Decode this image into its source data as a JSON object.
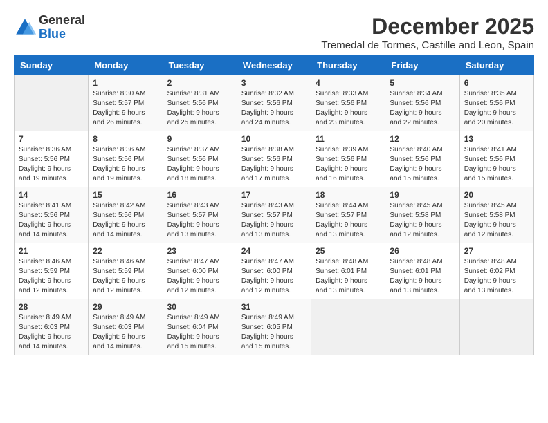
{
  "logo": {
    "general": "General",
    "blue": "Blue"
  },
  "title": "December 2025",
  "location": "Tremedal de Tormes, Castille and Leon, Spain",
  "days_of_week": [
    "Sunday",
    "Monday",
    "Tuesday",
    "Wednesday",
    "Thursday",
    "Friday",
    "Saturday"
  ],
  "weeks": [
    [
      {
        "day": "",
        "sunrise": "",
        "sunset": "",
        "daylight": ""
      },
      {
        "day": "1",
        "sunrise": "Sunrise: 8:30 AM",
        "sunset": "Sunset: 5:57 PM",
        "daylight": "Daylight: 9 hours and 26 minutes."
      },
      {
        "day": "2",
        "sunrise": "Sunrise: 8:31 AM",
        "sunset": "Sunset: 5:56 PM",
        "daylight": "Daylight: 9 hours and 25 minutes."
      },
      {
        "day": "3",
        "sunrise": "Sunrise: 8:32 AM",
        "sunset": "Sunset: 5:56 PM",
        "daylight": "Daylight: 9 hours and 24 minutes."
      },
      {
        "day": "4",
        "sunrise": "Sunrise: 8:33 AM",
        "sunset": "Sunset: 5:56 PM",
        "daylight": "Daylight: 9 hours and 23 minutes."
      },
      {
        "day": "5",
        "sunrise": "Sunrise: 8:34 AM",
        "sunset": "Sunset: 5:56 PM",
        "daylight": "Daylight: 9 hours and 22 minutes."
      },
      {
        "day": "6",
        "sunrise": "Sunrise: 8:35 AM",
        "sunset": "Sunset: 5:56 PM",
        "daylight": "Daylight: 9 hours and 20 minutes."
      }
    ],
    [
      {
        "day": "7",
        "sunrise": "Sunrise: 8:36 AM",
        "sunset": "Sunset: 5:56 PM",
        "daylight": "Daylight: 9 hours and 19 minutes."
      },
      {
        "day": "8",
        "sunrise": "Sunrise: 8:36 AM",
        "sunset": "Sunset: 5:56 PM",
        "daylight": "Daylight: 9 hours and 19 minutes."
      },
      {
        "day": "9",
        "sunrise": "Sunrise: 8:37 AM",
        "sunset": "Sunset: 5:56 PM",
        "daylight": "Daylight: 9 hours and 18 minutes."
      },
      {
        "day": "10",
        "sunrise": "Sunrise: 8:38 AM",
        "sunset": "Sunset: 5:56 PM",
        "daylight": "Daylight: 9 hours and 17 minutes."
      },
      {
        "day": "11",
        "sunrise": "Sunrise: 8:39 AM",
        "sunset": "Sunset: 5:56 PM",
        "daylight": "Daylight: 9 hours and 16 minutes."
      },
      {
        "day": "12",
        "sunrise": "Sunrise: 8:40 AM",
        "sunset": "Sunset: 5:56 PM",
        "daylight": "Daylight: 9 hours and 15 minutes."
      },
      {
        "day": "13",
        "sunrise": "Sunrise: 8:41 AM",
        "sunset": "Sunset: 5:56 PM",
        "daylight": "Daylight: 9 hours and 15 minutes."
      }
    ],
    [
      {
        "day": "14",
        "sunrise": "Sunrise: 8:41 AM",
        "sunset": "Sunset: 5:56 PM",
        "daylight": "Daylight: 9 hours and 14 minutes."
      },
      {
        "day": "15",
        "sunrise": "Sunrise: 8:42 AM",
        "sunset": "Sunset: 5:56 PM",
        "daylight": "Daylight: 9 hours and 14 minutes."
      },
      {
        "day": "16",
        "sunrise": "Sunrise: 8:43 AM",
        "sunset": "Sunset: 5:57 PM",
        "daylight": "Daylight: 9 hours and 13 minutes."
      },
      {
        "day": "17",
        "sunrise": "Sunrise: 8:43 AM",
        "sunset": "Sunset: 5:57 PM",
        "daylight": "Daylight: 9 hours and 13 minutes."
      },
      {
        "day": "18",
        "sunrise": "Sunrise: 8:44 AM",
        "sunset": "Sunset: 5:57 PM",
        "daylight": "Daylight: 9 hours and 13 minutes."
      },
      {
        "day": "19",
        "sunrise": "Sunrise: 8:45 AM",
        "sunset": "Sunset: 5:58 PM",
        "daylight": "Daylight: 9 hours and 12 minutes."
      },
      {
        "day": "20",
        "sunrise": "Sunrise: 8:45 AM",
        "sunset": "Sunset: 5:58 PM",
        "daylight": "Daylight: 9 hours and 12 minutes."
      }
    ],
    [
      {
        "day": "21",
        "sunrise": "Sunrise: 8:46 AM",
        "sunset": "Sunset: 5:59 PM",
        "daylight": "Daylight: 9 hours and 12 minutes."
      },
      {
        "day": "22",
        "sunrise": "Sunrise: 8:46 AM",
        "sunset": "Sunset: 5:59 PM",
        "daylight": "Daylight: 9 hours and 12 minutes."
      },
      {
        "day": "23",
        "sunrise": "Sunrise: 8:47 AM",
        "sunset": "Sunset: 6:00 PM",
        "daylight": "Daylight: 9 hours and 12 minutes."
      },
      {
        "day": "24",
        "sunrise": "Sunrise: 8:47 AM",
        "sunset": "Sunset: 6:00 PM",
        "daylight": "Daylight: 9 hours and 12 minutes."
      },
      {
        "day": "25",
        "sunrise": "Sunrise: 8:48 AM",
        "sunset": "Sunset: 6:01 PM",
        "daylight": "Daylight: 9 hours and 13 minutes."
      },
      {
        "day": "26",
        "sunrise": "Sunrise: 8:48 AM",
        "sunset": "Sunset: 6:01 PM",
        "daylight": "Daylight: 9 hours and 13 minutes."
      },
      {
        "day": "27",
        "sunrise": "Sunrise: 8:48 AM",
        "sunset": "Sunset: 6:02 PM",
        "daylight": "Daylight: 9 hours and 13 minutes."
      }
    ],
    [
      {
        "day": "28",
        "sunrise": "Sunrise: 8:49 AM",
        "sunset": "Sunset: 6:03 PM",
        "daylight": "Daylight: 9 hours and 14 minutes."
      },
      {
        "day": "29",
        "sunrise": "Sunrise: 8:49 AM",
        "sunset": "Sunset: 6:03 PM",
        "daylight": "Daylight: 9 hours and 14 minutes."
      },
      {
        "day": "30",
        "sunrise": "Sunrise: 8:49 AM",
        "sunset": "Sunset: 6:04 PM",
        "daylight": "Daylight: 9 hours and 15 minutes."
      },
      {
        "day": "31",
        "sunrise": "Sunrise: 8:49 AM",
        "sunset": "Sunset: 6:05 PM",
        "daylight": "Daylight: 9 hours and 15 minutes."
      },
      {
        "day": "",
        "sunrise": "",
        "sunset": "",
        "daylight": ""
      },
      {
        "day": "",
        "sunrise": "",
        "sunset": "",
        "daylight": ""
      },
      {
        "day": "",
        "sunrise": "",
        "sunset": "",
        "daylight": ""
      }
    ]
  ]
}
